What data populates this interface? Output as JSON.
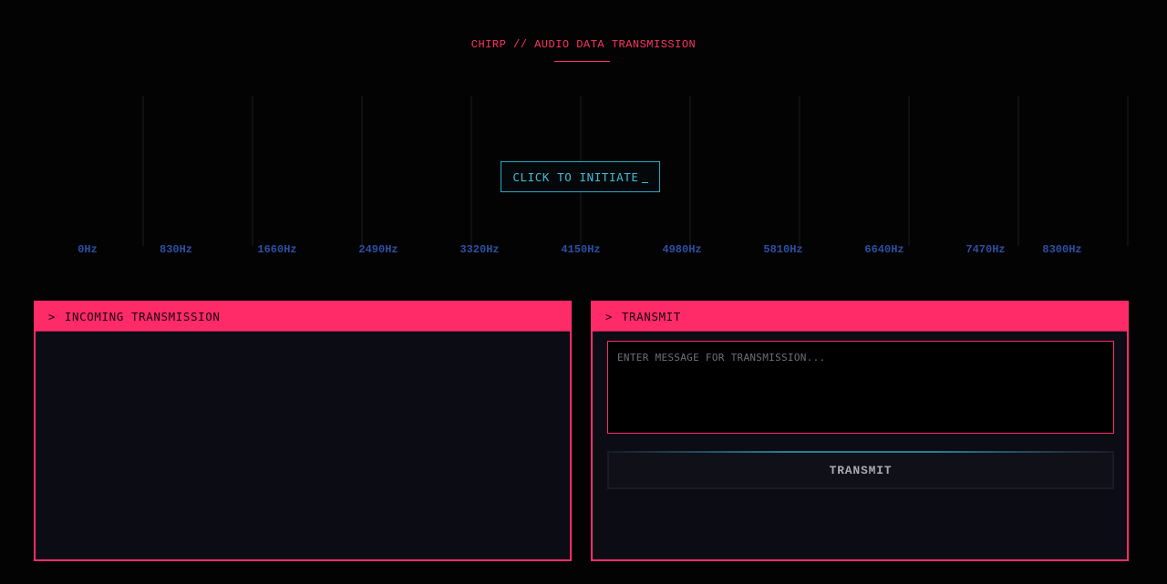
{
  "header": {
    "title": "CHIRP // AUDIO DATA TRANSMISSION"
  },
  "spectrum": {
    "frequencies": [
      "0Hz",
      "830Hz",
      "1660Hz",
      "2490Hz",
      "3320Hz",
      "4150Hz",
      "4980Hz",
      "5810Hz",
      "6640Hz",
      "7470Hz",
      "8300Hz"
    ],
    "initiate_label": "CLICK TO INITIATE"
  },
  "incoming": {
    "title": "INCOMING TRANSMISSION",
    "chevron": ">"
  },
  "transmit": {
    "title": "TRANSMIT",
    "chevron": ">",
    "placeholder": "ENTER MESSAGE FOR TRANSMISSION...",
    "value": "",
    "button_label": "TRANSMIT"
  },
  "colors": {
    "accent": "#ff2d6a",
    "cyan": "#2aa8c0",
    "freq_label": "#2e4fa3",
    "background": "#030304",
    "panel_bg": "#0c0c15"
  },
  "icons": {
    "chevron": "chevron-right-icon",
    "cursor": "text-cursor-icon"
  }
}
